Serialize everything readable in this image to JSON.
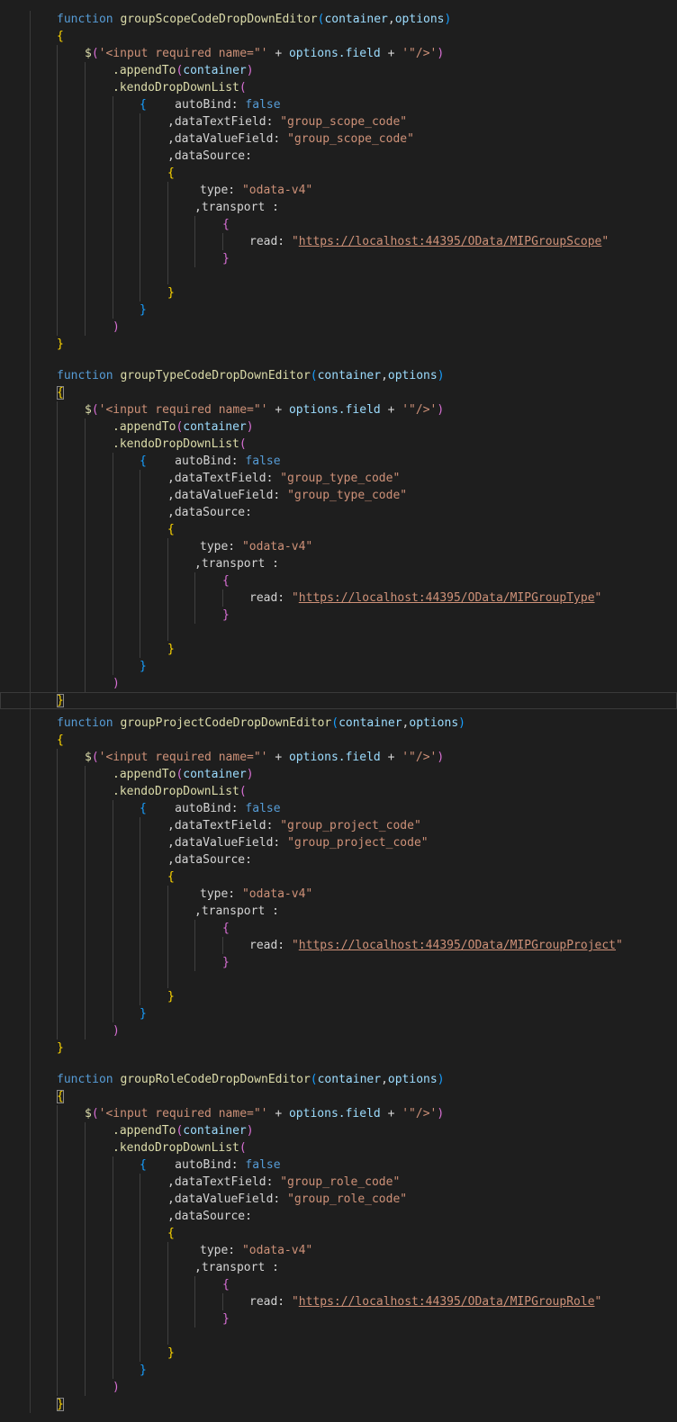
{
  "editor": {
    "blocks": [
      {
        "function_keyword": "function",
        "function_name": "groupScopeCodeDropDownEditor",
        "params": [
          "container",
          "options"
        ],
        "text_field": "\"group_scope_code\"",
        "value_field": "\"group_scope_code\"",
        "read_url": "https://localhost:44395/OData/MIPGroupScope"
      },
      {
        "function_keyword": "function",
        "function_name": "groupTypeCodeDropDownEditor",
        "params": [
          "container",
          "options"
        ],
        "text_field": "\"group_type_code\"",
        "value_field": "\"group_type_code\"",
        "read_url": "https://localhost:44395/OData/MIPGroupType"
      },
      {
        "function_keyword": "function",
        "function_name": "groupProjectCodeDropDownEditor",
        "params": [
          "container",
          "options"
        ],
        "text_field": "\"group_project_code\"",
        "value_field": "\"group_project_code\"",
        "read_url": "https://localhost:44395/OData/MIPGroupProject"
      },
      {
        "function_keyword": "function",
        "function_name": "groupRoleCodeDropDownEditor",
        "params": [
          "container",
          "options"
        ],
        "text_field": "\"group_role_code\"",
        "value_field": "\"group_role_code\"",
        "read_url": "https://localhost:44395/OData/MIPGroupRole"
      }
    ],
    "tokens": {
      "dollar": "$",
      "input_str": "'<input required name=\"'",
      "options_field": "options.field",
      "plus": "+",
      "close_str": "'\"/>'",
      "append_to": ".appendTo",
      "container": "container",
      "kendo": ".kendoDropDownList",
      "auto_bind": "autoBind:",
      "false_kw": "false",
      "data_text_field": ",dataTextField:",
      "data_value_field": ",dataValueField:",
      "data_source": ",dataSource:",
      "type_key": "type:",
      "type_value": "\"odata-v4\"",
      "transport": ",transport :",
      "read_key": "read:",
      "quote": "\""
    }
  }
}
